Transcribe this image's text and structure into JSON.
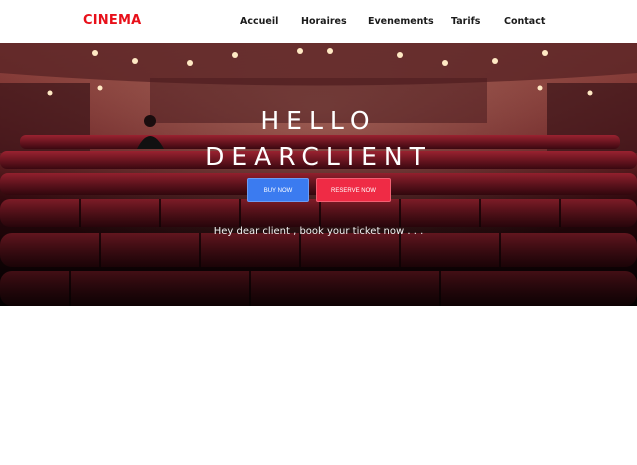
{
  "brand": {
    "name": "CINEMA",
    "color": "#e8101a"
  },
  "nav": {
    "items": [
      {
        "label": "Accueil"
      },
      {
        "label": "Horaires"
      },
      {
        "label": "Evenements"
      },
      {
        "label": "Tarifs"
      },
      {
        "label": "Contact"
      }
    ]
  },
  "hero": {
    "title_line1": "HELLO",
    "title_line2": "DEARCLIENT",
    "buy_button": "BUY NOW",
    "reserve_button": "RESERVE NOW",
    "subtitle": "Hey dear client , book your ticket now . . .",
    "background": "theater-seats-photo"
  },
  "colors": {
    "buy_button": "#3b7bf0",
    "reserve_button": "#ef2b45",
    "hero_tint": "#7a1a20"
  }
}
